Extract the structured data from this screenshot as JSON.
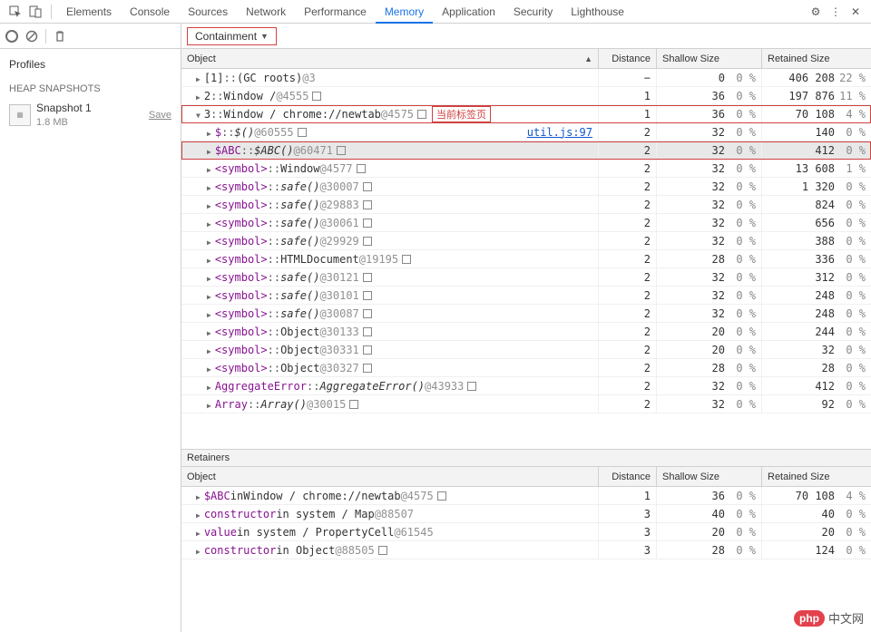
{
  "topbar": {
    "tabs": [
      "Elements",
      "Console",
      "Sources",
      "Network",
      "Performance",
      "Memory",
      "Application",
      "Security",
      "Lighthouse"
    ],
    "active": "Memory"
  },
  "toolbar": {
    "dropdown": "Containment"
  },
  "sidebar": {
    "profiles": "Profiles",
    "section": "HEAP SNAPSHOTS",
    "snapshot": {
      "name": "Snapshot 1",
      "size": "1.8 MB",
      "save": "Save"
    }
  },
  "headers": {
    "object": "Object",
    "distance": "Distance",
    "shallow": "Shallow Size",
    "retained": "Retained Size"
  },
  "rows": [
    {
      "lvl": 1,
      "tri": "r",
      "pre": "[1]",
      "sep": "::",
      "mid": "(GC roots)",
      "afterGray": "@3",
      "dist": "−",
      "shallow": "0",
      "shallowPct": "0 %",
      "retained": "406 208",
      "retainedPct": "22 %"
    },
    {
      "lvl": 1,
      "tri": "r",
      "pre": "2",
      "sep": "::",
      "mid": "Window /",
      "afterGray": "@4555",
      "sq": true,
      "dist": "1",
      "shallow": "36",
      "shallowPct": "0 %",
      "retained": "197 876",
      "retainedPct": "11 %"
    },
    {
      "lvl": 1,
      "tri": "d",
      "pre": "3",
      "sep": "::",
      "mid": "Window / chrome://newtab",
      "afterGray": "@4575",
      "sq": true,
      "annot": "当前标签页",
      "dist": "1",
      "shallow": "36",
      "shallowPct": "0 %",
      "retained": "70 108",
      "retainedPct": "4 %",
      "hl": "red"
    },
    {
      "lvl": 2,
      "tri": "r",
      "preP": "$",
      "sep": "::",
      "midI": "$()",
      "afterGray": "@60555",
      "sq": true,
      "link": "util.js:97",
      "dist": "2",
      "shallow": "32",
      "shallowPct": "0 %",
      "retained": "140",
      "retainedPct": "0 %"
    },
    {
      "lvl": 2,
      "tri": "r",
      "preP": "$ABC",
      "sep": "::",
      "midI": "$ABC()",
      "afterGray": "@60471",
      "sq": true,
      "dist": "2",
      "shallow": "32",
      "shallowPct": "0 %",
      "retained": "412",
      "retainedPct": "0 %",
      "hl": "red2"
    },
    {
      "lvl": 2,
      "tri": "r",
      "preP": "<symbol>",
      "sep": "::",
      "mid": "Window",
      "afterGray": "@4577",
      "sq": true,
      "dist": "2",
      "shallow": "32",
      "shallowPct": "0 %",
      "retained": "13 608",
      "retainedPct": "1 %"
    },
    {
      "lvl": 2,
      "tri": "r",
      "preP": "<symbol>",
      "sep": "::",
      "midI": "safe()",
      "afterGray": "@30007",
      "sq": true,
      "dist": "2",
      "shallow": "32",
      "shallowPct": "0 %",
      "retained": "1 320",
      "retainedPct": "0 %"
    },
    {
      "lvl": 2,
      "tri": "r",
      "preP": "<symbol>",
      "sep": "::",
      "midI": "safe()",
      "afterGray": "@29883",
      "sq": true,
      "dist": "2",
      "shallow": "32",
      "shallowPct": "0 %",
      "retained": "824",
      "retainedPct": "0 %"
    },
    {
      "lvl": 2,
      "tri": "r",
      "preP": "<symbol>",
      "sep": "::",
      "midI": "safe()",
      "afterGray": "@30061",
      "sq": true,
      "dist": "2",
      "shallow": "32",
      "shallowPct": "0 %",
      "retained": "656",
      "retainedPct": "0 %"
    },
    {
      "lvl": 2,
      "tri": "r",
      "preP": "<symbol>",
      "sep": "::",
      "midI": "safe()",
      "afterGray": "@29929",
      "sq": true,
      "dist": "2",
      "shallow": "32",
      "shallowPct": "0 %",
      "retained": "388",
      "retainedPct": "0 %"
    },
    {
      "lvl": 2,
      "tri": "r",
      "preP": "<symbol>",
      "sep": "::",
      "mid": "HTMLDocument",
      "afterGray": "@19195",
      "sq": true,
      "dist": "2",
      "shallow": "28",
      "shallowPct": "0 %",
      "retained": "336",
      "retainedPct": "0 %"
    },
    {
      "lvl": 2,
      "tri": "r",
      "preP": "<symbol>",
      "sep": "::",
      "midI": "safe()",
      "afterGray": "@30121",
      "sq": true,
      "dist": "2",
      "shallow": "32",
      "shallowPct": "0 %",
      "retained": "312",
      "retainedPct": "0 %"
    },
    {
      "lvl": 2,
      "tri": "r",
      "preP": "<symbol>",
      "sep": "::",
      "midI": "safe()",
      "afterGray": "@30101",
      "sq": true,
      "dist": "2",
      "shallow": "32",
      "shallowPct": "0 %",
      "retained": "248",
      "retainedPct": "0 %"
    },
    {
      "lvl": 2,
      "tri": "r",
      "preP": "<symbol>",
      "sep": "::",
      "midI": "safe()",
      "afterGray": "@30087",
      "sq": true,
      "dist": "2",
      "shallow": "32",
      "shallowPct": "0 %",
      "retained": "248",
      "retainedPct": "0 %"
    },
    {
      "lvl": 2,
      "tri": "r",
      "preP": "<symbol>",
      "sep": "::",
      "mid": "Object",
      "afterGray": "@30133",
      "sq": true,
      "dist": "2",
      "shallow": "20",
      "shallowPct": "0 %",
      "retained": "244",
      "retainedPct": "0 %"
    },
    {
      "lvl": 2,
      "tri": "r",
      "preP": "<symbol>",
      "sep": "::",
      "mid": "Object",
      "afterGray": "@30331",
      "sq": true,
      "dist": "2",
      "shallow": "20",
      "shallowPct": "0 %",
      "retained": "32",
      "retainedPct": "0 %"
    },
    {
      "lvl": 2,
      "tri": "r",
      "preP": "<symbol>",
      "sep": "::",
      "mid": "Object",
      "afterGray": "@30327",
      "sq": true,
      "dist": "2",
      "shallow": "28",
      "shallowPct": "0 %",
      "retained": "28",
      "retainedPct": "0 %"
    },
    {
      "lvl": 2,
      "tri": "r",
      "preP": "AggregateError",
      "sep": "::",
      "midI": "AggregateError()",
      "afterGray": "@43933",
      "sq": true,
      "dist": "2",
      "shallow": "32",
      "shallowPct": "0 %",
      "retained": "412",
      "retainedPct": "0 %"
    },
    {
      "lvl": 2,
      "tri": "r",
      "preP": "Array",
      "sep": "::",
      "midI": "Array()",
      "afterGray": "@30015",
      "sq": true,
      "dist": "2",
      "shallow": "32",
      "shallowPct": "0 %",
      "retained": "92",
      "retainedPct": "0 %"
    }
  ],
  "retainers": {
    "title": "Retainers",
    "rows": [
      {
        "tri": "r",
        "preP": "$ABC",
        "plain": " in ",
        "mid": "Window / chrome://newtab",
        "afterGray": "@4575",
        "sq": true,
        "dist": "1",
        "shallow": "36",
        "shallowPct": "0 %",
        "retained": "70 108",
        "retainedPct": "4 %"
      },
      {
        "tri": "r",
        "preP": "constructor",
        "plain": " in system / Map ",
        "afterGray": "@88507",
        "dist": "3",
        "shallow": "40",
        "shallowPct": "0 %",
        "retained": "40",
        "retainedPct": "0 %"
      },
      {
        "tri": "r",
        "preP": "value",
        "plain": " in system / PropertyCell ",
        "afterGray": "@61545",
        "dist": "3",
        "shallow": "20",
        "shallowPct": "0 %",
        "retained": "20",
        "retainedPct": "0 %"
      },
      {
        "tri": "r",
        "preP": "constructor",
        "plain": " in Object ",
        "afterGray": "@88505",
        "sq": true,
        "dist": "3",
        "shallow": "28",
        "shallowPct": "0 %",
        "retained": "124",
        "retainedPct": "0 %"
      }
    ]
  },
  "watermark": {
    "badge": "php",
    "text": "中文网"
  }
}
